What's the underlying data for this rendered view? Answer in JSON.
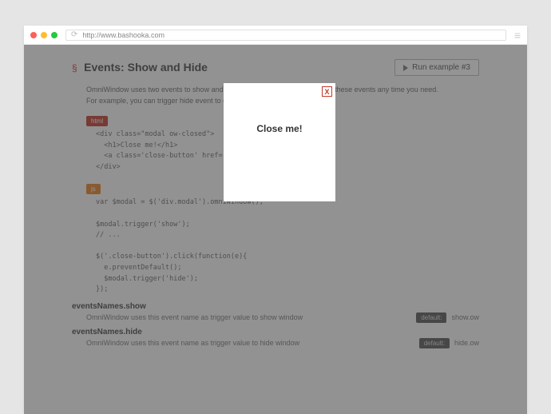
{
  "browser": {
    "url": "http://www.bashooka.com"
  },
  "page": {
    "section_link": "§",
    "heading": "Events: Show and Hide",
    "run_button": "Run example #3",
    "intro1": "OmniWindow uses two events to show and hide windows. So, you can trigger these events any time you need.",
    "intro2": "For example, you can trigger hide event to close modal:",
    "html_badge": "html",
    "html_code": "<div class=\"modal ow-closed\">\n  <h1>Close me!</h1>\n  <a class='close-button' href='#'>X</a>\n</div>",
    "js_badge": "js",
    "js_code": "var $modal = $('div.modal').omniWindow();\n\n$modal.trigger('show');\n// ...\n\n$('.close-button').click(function(e){\n  e.preventDefault();\n  $modal.trigger('hide');\n});",
    "props": [
      {
        "name": "eventsNames.show",
        "desc": "OmniWindow uses this event name as trigger value to show window",
        "default_label": "default:",
        "default_value": "show.ow"
      },
      {
        "name": "eventsNames.hide",
        "desc": "OmniWindow uses this event name as trigger value to hide window",
        "default_label": "default:",
        "default_value": "hide.ow"
      }
    ]
  },
  "modal": {
    "close_label": "X",
    "title": "Close me!"
  }
}
